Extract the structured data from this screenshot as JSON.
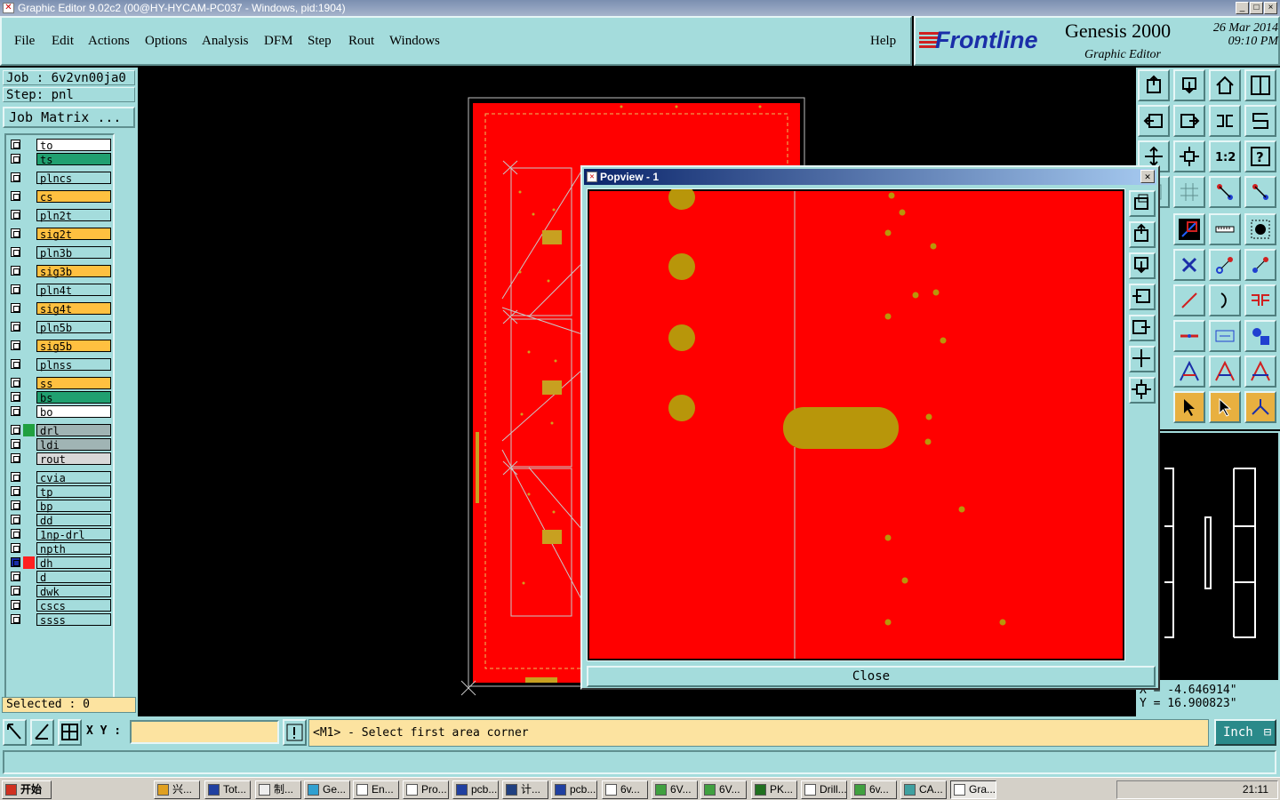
{
  "window": {
    "title": "Graphic Editor 9.02c2 (00@HY-HYCAM-PC037 - Windows, pid:1904)",
    "controls": [
      "_",
      "□",
      "×"
    ]
  },
  "menu": {
    "items": [
      "File",
      "Edit",
      "Actions",
      "Options",
      "Analysis",
      "DFM",
      "Step",
      "Rout",
      "Windows"
    ],
    "help": "Help"
  },
  "brand": {
    "logo": "Frontline",
    "product": "Genesis 2000",
    "subtitle": "Graphic Editor",
    "date": "26 Mar 2014",
    "time": "09:10 PM"
  },
  "job": {
    "job": "Job : 6v2vn00ja0",
    "step": "Step: pnl",
    "matrix_button": "Job Matrix ..."
  },
  "layers": [
    {
      "name": "to",
      "color": "#ffffff"
    },
    {
      "name": "ts",
      "color": "#20a070"
    },
    {
      "name": "plncs",
      "color": "#a4dcdc"
    },
    {
      "name": "cs",
      "color": "#ffc040"
    },
    {
      "name": "pln2t",
      "color": "#a4dcdc"
    },
    {
      "name": "sig2t",
      "color": "#ffc040"
    },
    {
      "name": "pln3b",
      "color": "#a4dcdc"
    },
    {
      "name": "sig3b",
      "color": "#ffc040"
    },
    {
      "name": "pln4t",
      "color": "#a4dcdc"
    },
    {
      "name": "sig4t",
      "color": "#ffc040"
    },
    {
      "name": "pln5b",
      "color": "#a4dcdc"
    },
    {
      "name": "sig5b",
      "color": "#ffc040"
    },
    {
      "name": "plnss",
      "color": "#a4dcdc"
    },
    {
      "name": "ss",
      "color": "#ffc040"
    },
    {
      "name": "bs",
      "color": "#20a070"
    },
    {
      "name": "bo",
      "color": "#ffffff"
    },
    {
      "name": "drl",
      "color": "#a0b4b4"
    },
    {
      "name": "ldi",
      "color": "#a0b4b4"
    },
    {
      "name": "rout",
      "color": "#d8d8d8"
    },
    {
      "name": "cvia",
      "color": "#a4dcdc"
    },
    {
      "name": "tp",
      "color": "#a4dcdc"
    },
    {
      "name": "bp",
      "color": "#a4dcdc"
    },
    {
      "name": "dd",
      "color": "#a4dcdc"
    },
    {
      "name": "1np-drl",
      "color": "#a4dcdc"
    },
    {
      "name": "npth",
      "color": "#a4dcdc"
    },
    {
      "name": "dh",
      "color": "#a4dcdc"
    },
    {
      "name": "d",
      "color": "#a4dcdc"
    },
    {
      "name": "dwk",
      "color": "#a4dcdc"
    },
    {
      "name": "cscs",
      "color": "#a4dcdc"
    },
    {
      "name": "ssss",
      "color": "#a4dcdc"
    }
  ],
  "selected": "Selected : 0",
  "popview": {
    "title": "Popview - 1",
    "close_label": "Close"
  },
  "coords": {
    "x": "X = -4.646914\"",
    "y": "Y = 16.900823\""
  },
  "command": {
    "xy_label": "X Y :",
    "xy_value": "",
    "prompt": "<M1> - Select first area corner",
    "unit": "Inch"
  },
  "taskbar": {
    "start": "开始",
    "tasks": [
      "兴...",
      "Tot...",
      "制...",
      "Ge...",
      "En...",
      "Pro...",
      "pcb...",
      "计...",
      "pcb...",
      "6v...",
      "6V...",
      "6V...",
      "PK...",
      "Drill...",
      "6v...",
      "CA...",
      "Gra..."
    ],
    "clock": "21:11"
  },
  "colors": {
    "panel": "#a4dcdc",
    "board": "#ff0000",
    "pad": "#b8960a",
    "prompt_bg": "#fce3a0"
  }
}
